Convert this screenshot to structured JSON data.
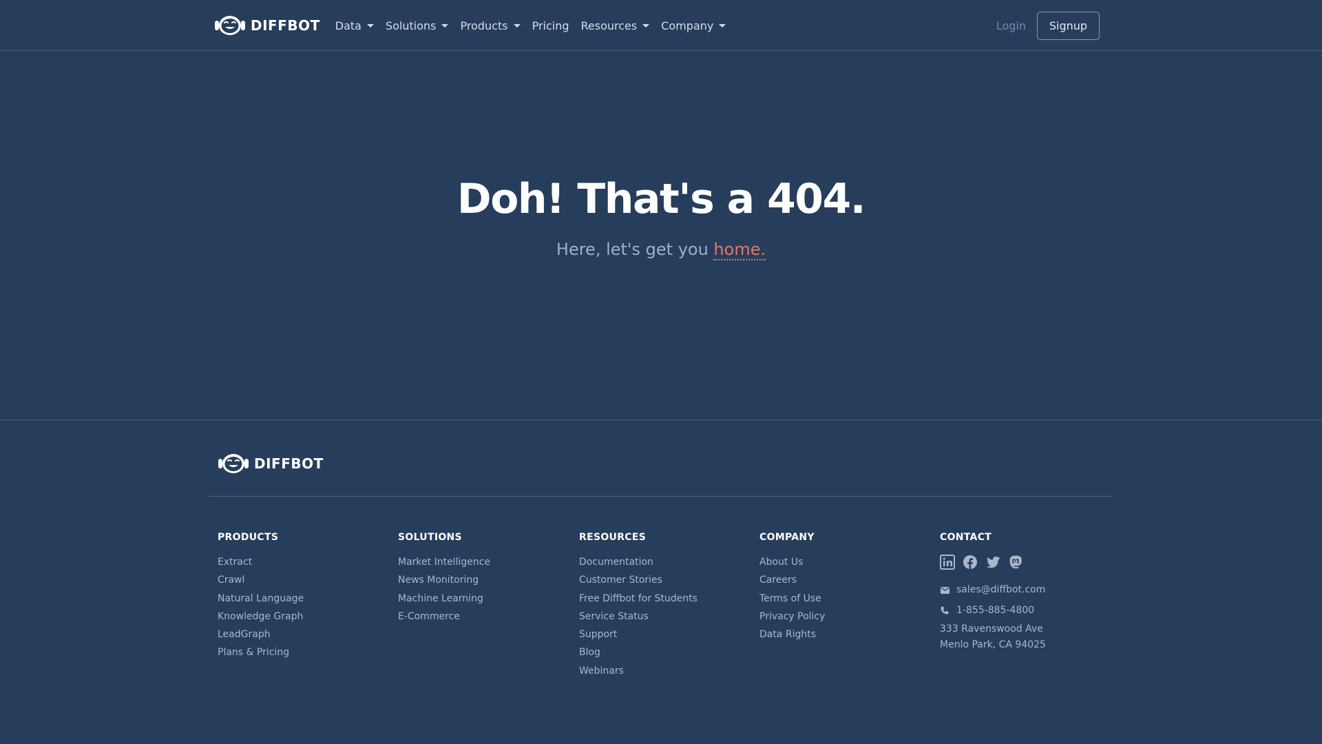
{
  "navbar": {
    "brand": "DIFFBOT",
    "items": [
      {
        "label": "Data",
        "dropdown": true
      },
      {
        "label": "Solutions",
        "dropdown": true
      },
      {
        "label": "Products",
        "dropdown": true
      },
      {
        "label": "Pricing",
        "dropdown": false
      },
      {
        "label": "Resources",
        "dropdown": true
      },
      {
        "label": "Company",
        "dropdown": true
      }
    ],
    "login_label": "Login",
    "signup_label": "Signup"
  },
  "hero": {
    "title": "Doh! That's a 404.",
    "subtitle_prefix": "Here, let's get you ",
    "home_link": "home."
  },
  "footer": {
    "brand": "DIFFBOT",
    "columns": [
      {
        "heading": "PRODUCTS",
        "links": [
          "Extract",
          "Crawl",
          "Natural Language",
          "Knowledge Graph",
          "LeadGraph",
          "Plans & Pricing"
        ]
      },
      {
        "heading": "SOLUTIONS",
        "links": [
          "Market Intelligence",
          "News Monitoring",
          "Machine Learning",
          "E-Commerce"
        ]
      },
      {
        "heading": "RESOURCES",
        "links": [
          "Documentation",
          "Customer Stories",
          "Free Diffbot for Students",
          "Service Status",
          "Support",
          "Blog",
          "Webinars"
        ]
      },
      {
        "heading": "COMPANY",
        "links": [
          "About Us",
          "Careers",
          "Terms of Use",
          "Privacy Policy",
          "Data Rights"
        ]
      }
    ],
    "contact": {
      "heading": "CONTACT",
      "social_icons": [
        "linkedin-icon",
        "facebook-icon",
        "twitter-icon",
        "mastodon-icon"
      ],
      "email": "sales@diffbot.com",
      "phone": "1-855-885-4800",
      "address_line1": "333 Ravenswood Ave",
      "address_line2": "Menlo Park, CA 94025"
    }
  },
  "colors": {
    "background": "#273d5c",
    "accent_link": "#e07a66",
    "login": "#6d8bb1"
  }
}
